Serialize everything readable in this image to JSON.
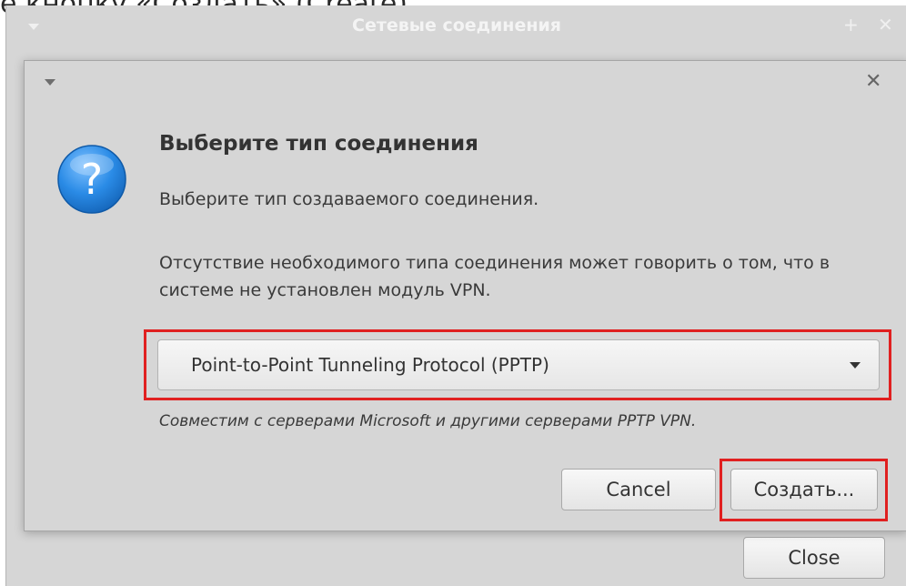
{
  "caption": {
    "text": "е кнопку «Создать» (Create)."
  },
  "parent_window": {
    "title": "Сетевые соединения",
    "close_label": "Close",
    "maximize_glyph": "+",
    "close_glyph": "✕"
  },
  "dialog": {
    "close_glyph": "✕",
    "heading": "Выберите тип соединения",
    "subtext": "Выберите тип создаваемого соединения.",
    "info": "Отсутствие необходимого типа соединения может говорить о том, что в системе не установлен модуль VPN.",
    "connection_type": {
      "selected": "Point-to-Point Tunneling Protocol (PPTP)"
    },
    "hint": "Совместим с серверами Microsoft и другими серверами PPTP VPN.",
    "cancel_label": "Cancel",
    "create_label": "Создать..."
  },
  "icons": {
    "dialog": "question-icon",
    "dropdown": "chevron-down-icon"
  },
  "colors": {
    "highlight": "#e02020",
    "icon_blue": "#1f7fd6",
    "window_bg": "#d6d6d6"
  }
}
